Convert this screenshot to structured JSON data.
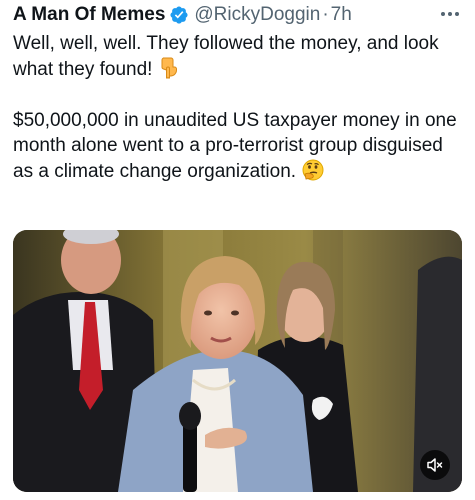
{
  "author": {
    "display_name": "A Man Of Memes",
    "handle": "@RickyDoggin",
    "separator": "·",
    "time": "7h",
    "verified_icon": "verified-badge-icon",
    "verified_color": "#1d9bf0"
  },
  "more_icon": "more-dots-icon",
  "tweet": {
    "paragraph1": "Well, well, well. They followed the money, and look what they found!",
    "emoji1": "pointing-down-hand-emoji",
    "paragraph2": "$50,000,000 in unaudited US taxpayer money in one month alone went to a pro-terrorist group disguised as a climate change organization.",
    "emoji2": "thinking-face-emoji"
  },
  "media": {
    "type": "video",
    "mute_icon": "muted-speaker-icon"
  }
}
